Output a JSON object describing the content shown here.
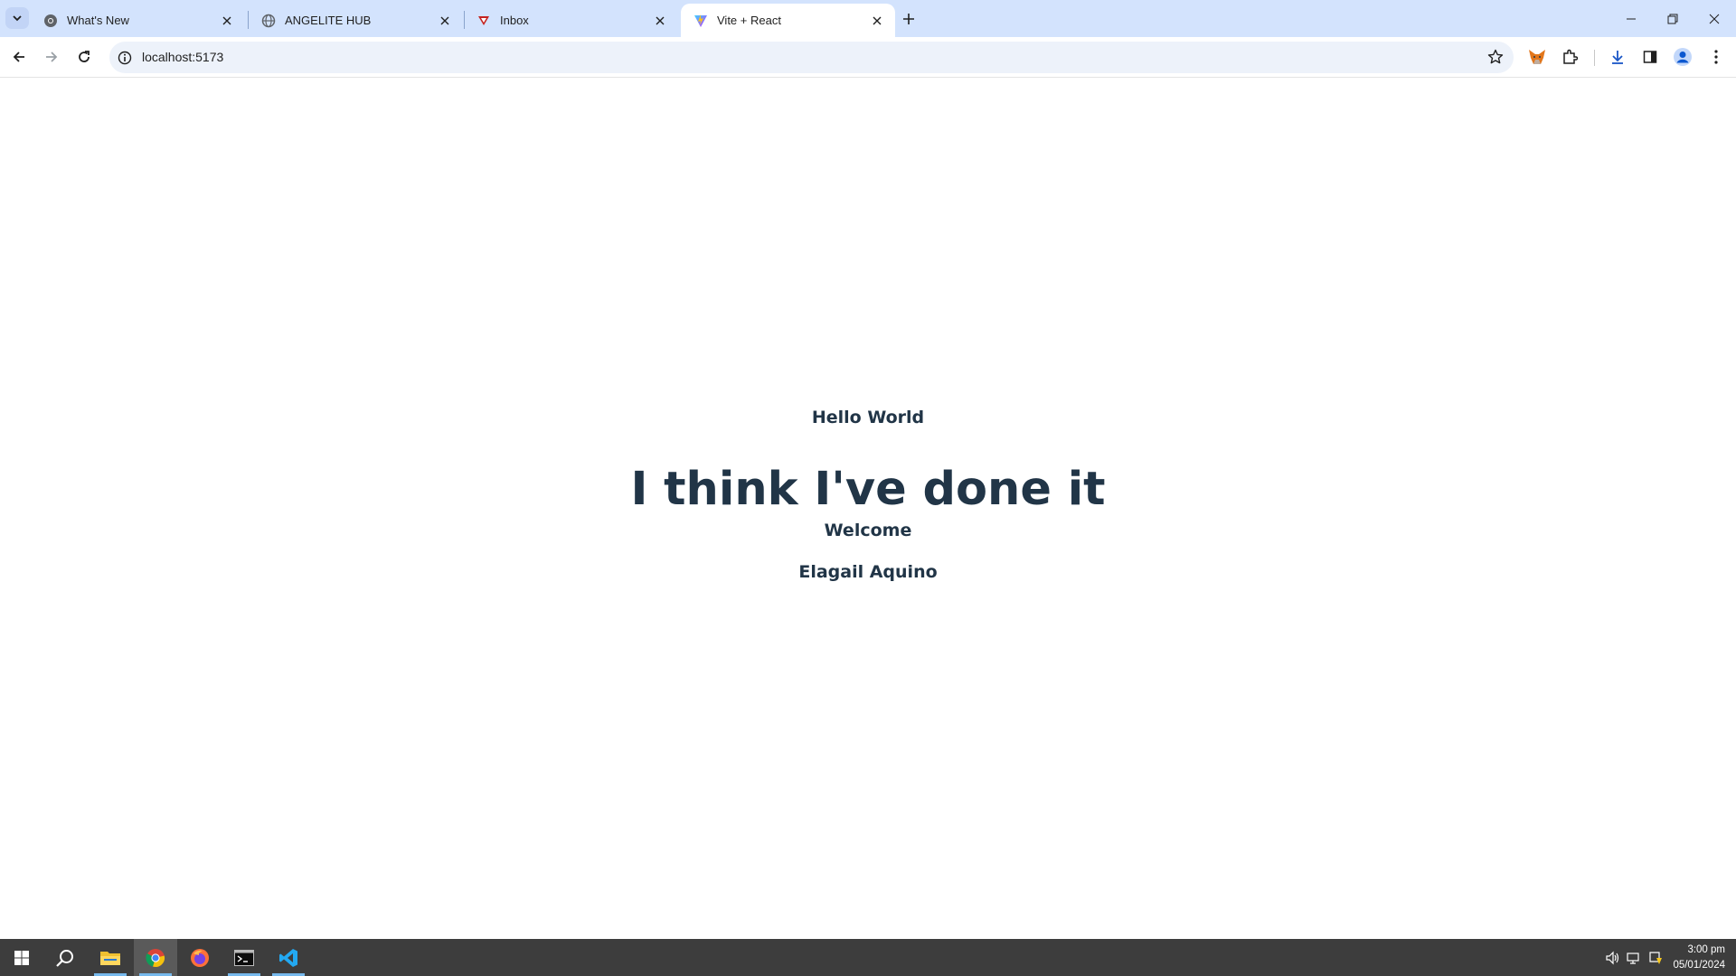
{
  "browser": {
    "tabs": [
      {
        "title": "What's New",
        "icon": "chrome-icon",
        "active": false
      },
      {
        "title": "ANGELITE HUB",
        "icon": "globe-icon",
        "active": false
      },
      {
        "title": "Inbox",
        "icon": "mail-icon",
        "active": false
      },
      {
        "title": "Vite + React",
        "icon": "vite-icon",
        "active": true
      }
    ],
    "address": "localhost:5173"
  },
  "page": {
    "hello": "Hello World",
    "headline": "I think I've done it",
    "welcome": "Welcome",
    "name": "Elagail Aquino"
  },
  "taskbar": {
    "apps": [
      "start-icon",
      "search-icon",
      "file-explorer-icon",
      "chrome-icon",
      "firefox-icon",
      "terminal-icon",
      "vscode-icon"
    ],
    "time": "3:00 pm",
    "date": "05/01/2024"
  },
  "colors": {
    "tabstrip": "#d3e3fd",
    "omnibox": "#edf2fa",
    "page_text": "#213547",
    "taskbar": "#3d3d3d"
  }
}
